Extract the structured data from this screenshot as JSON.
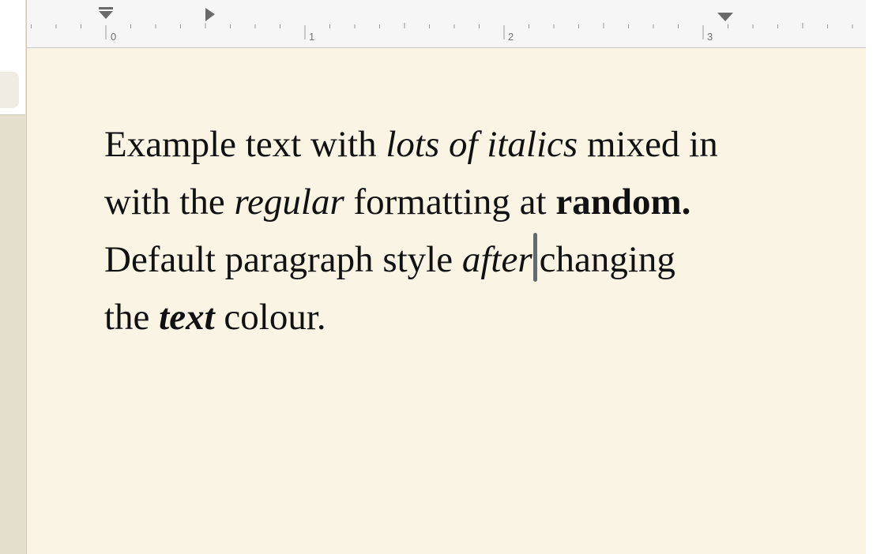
{
  "ruler": {
    "numbers": [
      "0",
      "1",
      "2",
      "3"
    ]
  },
  "document": {
    "lines": [
      [
        {
          "text": "Example text with ",
          "style": "regular"
        },
        {
          "text": "lots of italics",
          "style": "italic"
        },
        {
          "text": " mixed in",
          "style": "regular"
        }
      ],
      [
        {
          "text": "with the ",
          "style": "regular"
        },
        {
          "text": "regular",
          "style": "italic"
        },
        {
          "text": " formatting at ",
          "style": "regular"
        },
        {
          "text": "random.",
          "style": "bold"
        }
      ],
      [
        {
          "text": "Default paragraph style ",
          "style": "regular"
        },
        {
          "text": "after",
          "style": "italic"
        },
        {
          "text": "changing",
          "style": "regular"
        }
      ],
      [
        {
          "text": "the ",
          "style": "regular"
        },
        {
          "text": "text",
          "style": "bold-italic"
        },
        {
          "text": " colour.",
          "style": "regular"
        }
      ]
    ]
  },
  "colors": {
    "page_background": "#faf4e4",
    "caret": "#5f6b70",
    "text": "#111111"
  }
}
